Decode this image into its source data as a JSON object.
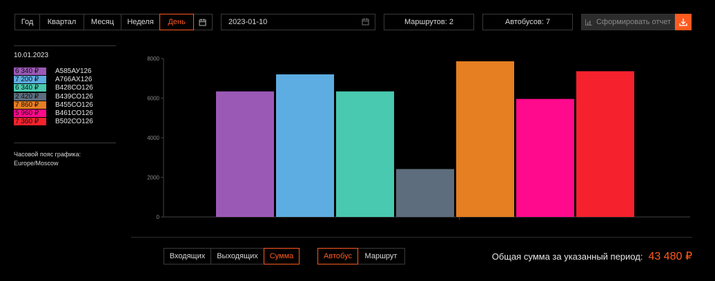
{
  "toolbar": {
    "periods": [
      "Год",
      "Квартал",
      "Месяц",
      "Неделя",
      "День"
    ],
    "active_period": 4,
    "date_value": "2023-01-10",
    "routes_label": "Маршрутов: 2",
    "buses_label": "Автобусов: 7",
    "report_label": "Сформировать отчет"
  },
  "legend": {
    "date": "10.01.2023",
    "items": [
      {
        "value": "6 340 ₽",
        "name": "А585АУ126",
        "color": "#9b59b6"
      },
      {
        "value": "7 200 ₽",
        "name": "А766АХ126",
        "color": "#5dade2"
      },
      {
        "value": "6 340 ₽",
        "name": "В428СО126",
        "color": "#48c9b0"
      },
      {
        "value": "2 420 ₽",
        "name": "В439СО126",
        "color": "#5d6d7e"
      },
      {
        "value": "7 860 ₽",
        "name": "В455СО126",
        "color": "#e67e22"
      },
      {
        "value": "5 960 ₽",
        "name": "В461СО126",
        "color": "#ff0a8c"
      },
      {
        "value": "7 360 ₽",
        "name": "В502СО126",
        "color": "#f5222d"
      }
    ],
    "tz_label": "Часовой пояс графика:",
    "tz_value": "Europe/Moscow"
  },
  "chart_data": {
    "type": "bar",
    "categories": [
      "А585АУ126",
      "А766АХ126",
      "В428СО126",
      "В439СО126",
      "В455СО126",
      "В461СО126",
      "В502СО126"
    ],
    "values": [
      6340,
      7200,
      6340,
      2420,
      7860,
      5960,
      7360
    ],
    "colors": [
      "#9b59b6",
      "#5dade2",
      "#48c9b0",
      "#5d6d7e",
      "#e67e22",
      "#ff0a8c",
      "#f5222d"
    ],
    "yticks": [
      0,
      2000,
      4000,
      6000,
      8000
    ],
    "ylim": [
      0,
      8000
    ],
    "title": "",
    "xlabel": "",
    "ylabel": ""
  },
  "bottom": {
    "measures": [
      "Входящих",
      "Выходящих",
      "Сумма"
    ],
    "active_measure": 2,
    "groups": [
      "Автобус",
      "Маршрут"
    ],
    "active_group": 0,
    "total_label": "Общая сумма за указанный период:",
    "total_value": "43 480 ₽"
  },
  "colors": {
    "accent": "#ff5a1f",
    "background": "#000000"
  }
}
